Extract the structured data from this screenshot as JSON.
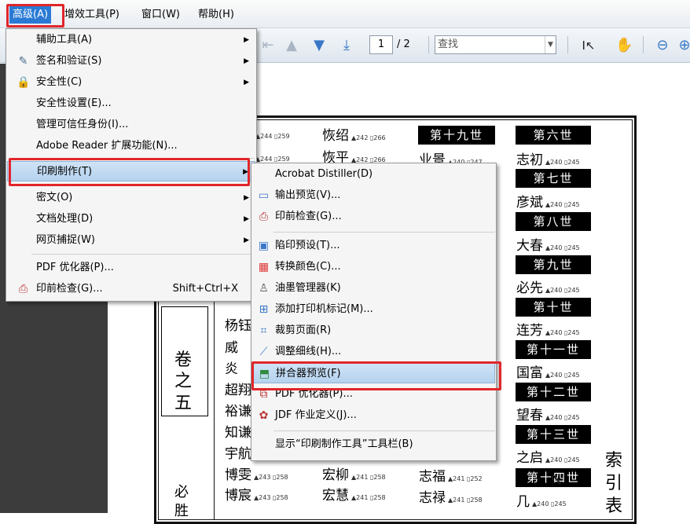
{
  "menubar": {
    "items": [
      "高级(A)",
      "增效工具(P)",
      "窗口(W)",
      "帮助(H)"
    ]
  },
  "toolbar": {
    "page_current": "1",
    "page_total": "/ 2",
    "search_placeholder": "查找"
  },
  "advanced_menu": {
    "items": [
      {
        "label": "辅助工具(A)",
        "icon": "none",
        "submenu": true
      },
      {
        "label": "签名和验证(S)",
        "icon": "pen-icon",
        "submenu": true
      },
      {
        "label": "安全性(C)",
        "icon": "lock-icon",
        "submenu": true
      },
      {
        "label": "安全性设置(E)...",
        "icon": "none"
      },
      {
        "label": "管理可信任身份(I)...",
        "icon": "none"
      },
      {
        "label": "Adobe Reader 扩展功能(N)...",
        "icon": "none"
      },
      {
        "label": "印刷制作(T)",
        "icon": "none",
        "submenu": true,
        "highlighted": true
      },
      {
        "label": "密文(O)",
        "icon": "none",
        "submenu": true
      },
      {
        "label": "文档处理(D)",
        "icon": "none",
        "submenu": true
      },
      {
        "label": "网页捕捉(W)",
        "icon": "none",
        "submenu": true
      },
      {
        "label": "PDF 优化器(P)...",
        "icon": "none"
      },
      {
        "label": "印前检查(G)...",
        "icon": "preflight-icon",
        "shortcut": "Shift+Ctrl+X"
      }
    ]
  },
  "print_menu": {
    "items": [
      {
        "label": "Acrobat Distiller(D)",
        "icon": "none"
      },
      {
        "label": "输出预览(V)...",
        "icon": "output-preview-icon"
      },
      {
        "label": "印前检查(G)...",
        "icon": "preflight-icon"
      },
      {
        "label": "陷印预设(T)...",
        "icon": "trap-icon"
      },
      {
        "label": "转换颜色(C)...",
        "icon": "color-icon"
      },
      {
        "label": "油墨管理器(K)",
        "icon": "ink-icon"
      },
      {
        "label": "添加打印机标记(M)...",
        "icon": "printer-marks-icon"
      },
      {
        "label": "裁剪页面(R)",
        "icon": "crop-icon"
      },
      {
        "label": "调整细线(H)...",
        "icon": "hairline-icon"
      },
      {
        "label": "拼合器预览(F)",
        "icon": "flattener-icon",
        "highlighted": true
      },
      {
        "label": "PDF 优化器(P)...",
        "icon": "optimizer-icon"
      },
      {
        "label": "JDF 作业定义(J)...",
        "icon": "jdf-icon"
      },
      {
        "label": "显示“印刷制作工具”工具栏(B)",
        "icon": "none"
      }
    ]
  },
  "document": {
    "generations": [
      "第十九世",
      "第六世",
      "第七世",
      "第八世",
      "第九世",
      "第十世",
      "第十一世",
      "第十二世",
      "第十三世",
      "第十四世"
    ],
    "names": [
      {
        "text": "恢绍",
        "ref": "▲242 ▯266"
      },
      {
        "text": "恢平",
        "ref": "▲242 ▯266"
      },
      {
        "text": "业景",
        "ref": "▲240 ▯247"
      },
      {
        "text": "志初",
        "ref": "▲240 ▯245"
      },
      {
        "text": "彦斌",
        "ref": "▲240 ▯245"
      },
      {
        "text": "大春",
        "ref": "▲240 ▯245"
      },
      {
        "text": "必先",
        "ref": "▲240 ▯245"
      },
      {
        "text": "连芳",
        "ref": "▲240 ▯245"
      },
      {
        "text": "国富",
        "ref": "▲240 ▯245"
      },
      {
        "text": "望春",
        "ref": "▲240 ▯245"
      },
      {
        "text": "之启",
        "ref": "▲240 ▯245"
      },
      {
        "text": "几",
        "ref": "▲240 ▯245"
      },
      {
        "text": "博雯",
        "ref": "▲243 ▯258"
      },
      {
        "text": "博宸",
        "ref": "▲243 ▯258"
      },
      {
        "text": "宏柳",
        "ref": "▲241 ▯258"
      },
      {
        "text": "宏慧",
        "ref": "▲241 ▯258"
      },
      {
        "text": "志福",
        "ref": "▲241 ▯252"
      },
      {
        "text": "志禄",
        "ref": "▲241 ▯258"
      }
    ],
    "left_refs": [
      "▲244 ▯259",
      "▲244 ▯259"
    ],
    "left_column": [
      "杨钰",
      "威",
      "炎",
      "超翔",
      "裕谦",
      "知谦",
      "宇航"
    ],
    "volume": [
      "卷",
      "之",
      "五"
    ],
    "volume_bottom": [
      "必",
      "胜"
    ],
    "index_label": [
      "索",
      "引",
      "表"
    ]
  }
}
